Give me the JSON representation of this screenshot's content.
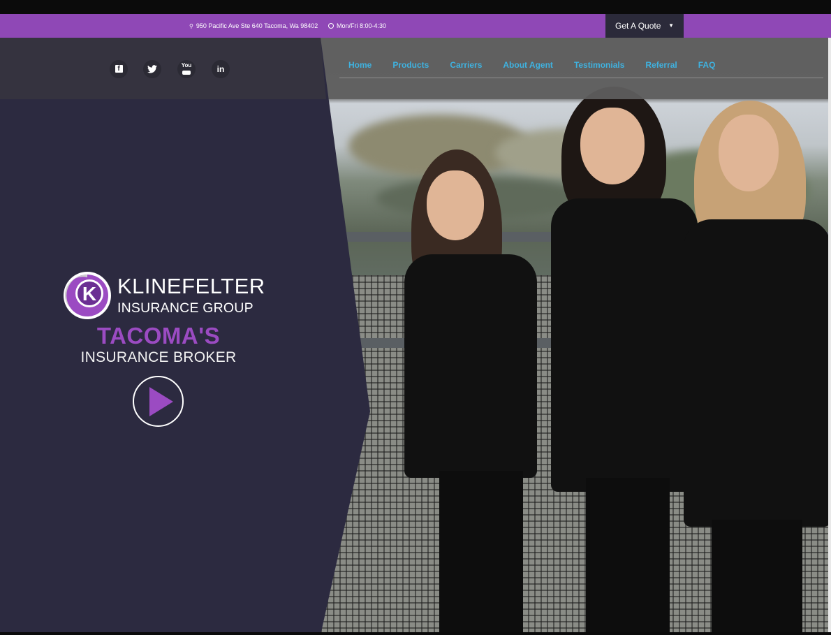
{
  "topbar": {
    "address": "950 Pacific Ave Ste 640 Tacoma, Wa 98402",
    "hours": "Mon/Fri 8:00-4:30",
    "quote_button": "Get A Quote",
    "bg_color": "#8f48b6"
  },
  "social": [
    {
      "icon": "facebook-icon",
      "glyph": "f"
    },
    {
      "icon": "twitter-icon",
      "glyph": "t"
    },
    {
      "icon": "youtube-icon",
      "glyph": "You"
    },
    {
      "icon": "linkedin-icon",
      "glyph": "in"
    }
  ],
  "nav": {
    "items": [
      "Home",
      "Products",
      "Carriers",
      "About Agent",
      "Testimonials",
      "Referral",
      "FAQ"
    ],
    "color": "#3fb2e0"
  },
  "hero": {
    "brand_line1": "KLINEFELTER",
    "brand_line2": "INSURANCE GROUP",
    "logo_letter": "K",
    "tagline_1": "TACOMA'S",
    "tagline_2": "INSURANCE BROKER",
    "accent_color": "#9b4bc2",
    "panel_color": "#2c2a40"
  }
}
